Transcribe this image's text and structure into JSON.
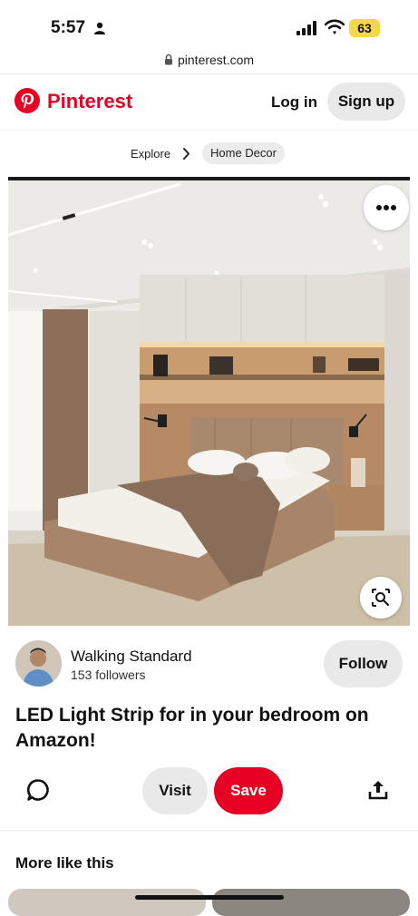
{
  "status_bar": {
    "time": "5:57",
    "battery": "63"
  },
  "browser": {
    "url": "pinterest.com"
  },
  "header": {
    "brand": "Pinterest",
    "login_label": "Log in",
    "signup_label": "Sign up"
  },
  "breadcrumb": {
    "items": [
      "Explore",
      "Home Decor"
    ]
  },
  "pin": {
    "author_name": "Walking Standard",
    "followers": "153 followers",
    "follow_label": "Follow",
    "title": "LED Light Strip for in your bedroom on Amazon!",
    "visit_label": "Visit",
    "save_label": "Save"
  },
  "related": {
    "title": "More like this"
  },
  "colors": {
    "brand": "#e60023",
    "button_bg": "#e9e9e9"
  }
}
